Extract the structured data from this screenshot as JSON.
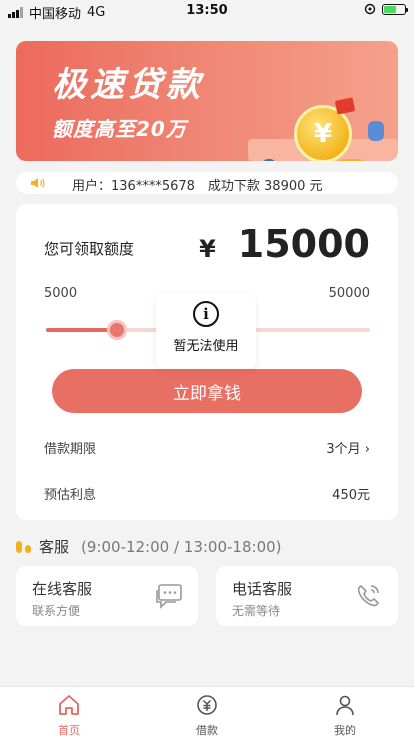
{
  "status_bar": {
    "carrier": "中国移动",
    "network": "4G",
    "time": "13:50"
  },
  "banner": {
    "title": "极速贷款",
    "subtitle": "额度高至20万",
    "coin_symbol": "¥"
  },
  "notice": {
    "text": "用户：136****5678　成功下款 38900 元"
  },
  "loan": {
    "quota_label": "您可领取额度",
    "currency": "¥",
    "amount": "15000",
    "min": "5000",
    "max": "50000",
    "slider_fraction": 0.22,
    "cta_label": "立即拿钱",
    "term_label": "借款期限",
    "term_value": "3个月",
    "term_chevron": "›",
    "interest_label": "预估利息",
    "interest_value": "450元"
  },
  "toast": {
    "icon": "i",
    "message": "暂无法使用"
  },
  "customer_service": {
    "title": "客服",
    "hours": "(9:00-12:00 / 13:00-18:00)",
    "online": {
      "title": "在线客服",
      "subtitle": "联系方便"
    },
    "phone": {
      "title": "电话客服",
      "subtitle": "无需等待"
    }
  },
  "tabbar": {
    "home": "首页",
    "loan": "借款",
    "mine": "我的"
  },
  "colors": {
    "accent": "#e06a5f",
    "button": "#e86f63",
    "gold": "#f1b21c"
  }
}
